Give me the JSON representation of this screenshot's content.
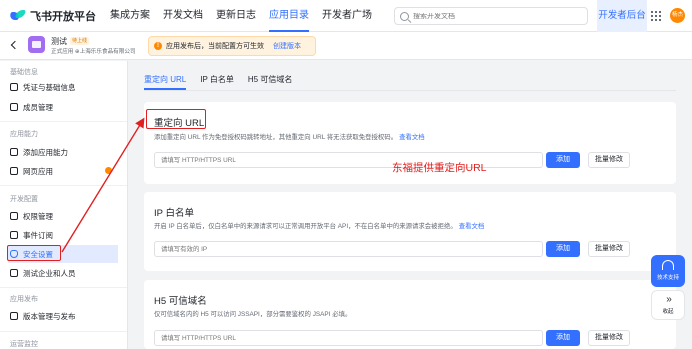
{
  "topbar": {
    "brand": "飞书开放平台",
    "nav": [
      {
        "label": "集成方案",
        "active": false
      },
      {
        "label": "开发文档",
        "active": false
      },
      {
        "label": "更新日志",
        "active": false
      },
      {
        "label": "应用目录",
        "active": true
      },
      {
        "label": "开发者广场",
        "active": false
      }
    ],
    "search_placeholder": "搜索开发文档",
    "dev_console": "开发者后台",
    "avatar_text": "杨杰"
  },
  "app": {
    "name": "测试",
    "badge": "待上线",
    "subtitle": "正式应用 ⊕上海乐乐食品有限公司",
    "notice": "应用发布后，当前配置方可生效",
    "notice_link": "创建版本"
  },
  "sidebar": {
    "groups": [
      "基础信息",
      "应用能力",
      "开发配置",
      "应用发布",
      "运营监控"
    ],
    "items": [
      {
        "label": "凭证与基础信息",
        "active": false
      },
      {
        "label": "成员管理",
        "active": false
      },
      {
        "label": "添加应用能力",
        "active": false
      },
      {
        "label": "网页应用",
        "active": false,
        "dot": true
      },
      {
        "label": "权限管理",
        "active": false
      },
      {
        "label": "事件订阅",
        "active": false
      },
      {
        "label": "安全设置",
        "active": true
      },
      {
        "label": "测试企业和人员",
        "active": false
      },
      {
        "label": "版本管理与发布",
        "active": false
      }
    ]
  },
  "tabs": [
    "重定向 URL",
    "IP 白名单",
    "H5 可信域名"
  ],
  "cards": [
    {
      "title": "重定向 URL",
      "desc": "添加重定向 URL 作为免登授权码跳转地址，其他重定向 URL 将无法获取免登授权码。",
      "link": "查看文档",
      "placeholder": "请填写 HTTP/HTTPS URL",
      "add": "添加",
      "batch": "批量修改"
    },
    {
      "title": "IP 白名单",
      "desc": "开启 IP 白名单后，仅白名单中的来源请求可以正常调用开放平台 API，不在白名单中的来源请求会被拒绝。",
      "link": "查看文档",
      "placeholder": "请填写有效的 IP",
      "add": "添加",
      "batch": "批量修改"
    },
    {
      "title": "H5 可信域名",
      "desc": "仅可信域名内的 H5 可以访问 JSSAPI，部分需要鉴权的 JSAPI 必填。",
      "link": "",
      "placeholder": "请填写 HTTP/HTTPS URL",
      "add": "添加",
      "batch": "批量修改"
    }
  ],
  "annotation": "东福提供重定向URL",
  "floating": {
    "support": "技术支持",
    "collapse": "收起"
  },
  "colors": {
    "primary": "#3370ff",
    "annotation_red": "#e02020",
    "warning": "#ff8800"
  }
}
